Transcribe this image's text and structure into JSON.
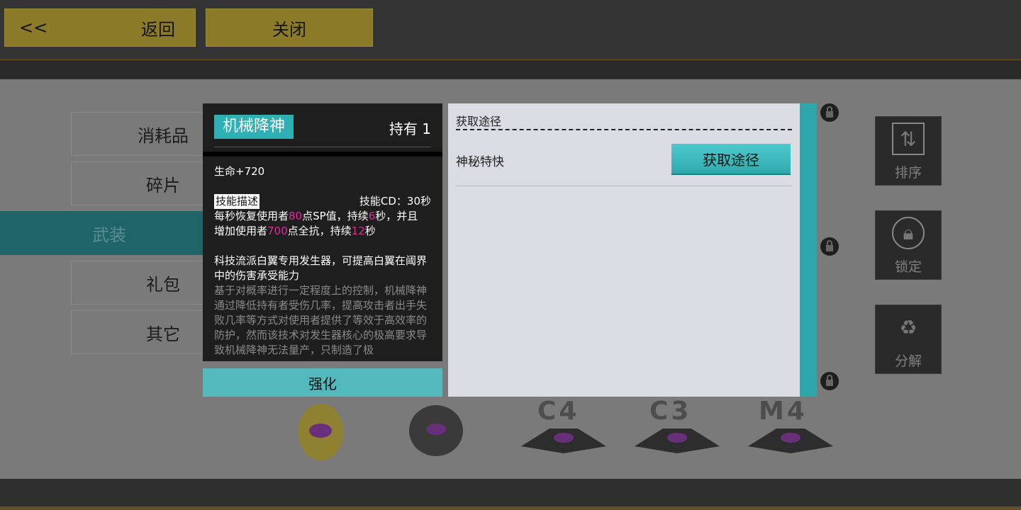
{
  "topbar": {
    "back_arrow": "<<",
    "back_label": "返回",
    "close_label": "关闭"
  },
  "categories": [
    "消耗品",
    "碎片",
    "武装",
    "礼包",
    "其它"
  ],
  "selected_category": "武装",
  "side_buttons": [
    {
      "label": "排序",
      "icon": "sort-icon"
    },
    {
      "label": "锁定",
      "icon": "lock-icon"
    },
    {
      "label": "分解",
      "icon": "recycle-icon"
    }
  ],
  "item_slots": [
    "",
    "",
    "C4",
    "C3",
    "M4"
  ],
  "detail": {
    "name": "机械降神",
    "hold": "持有 1",
    "stat": "生命+720",
    "skill_tag": "技能描述",
    "skill_cd": "技能CD：30秒",
    "skill_l1_a": "每秒恢复使用者",
    "skill_l1_v1": "80",
    "skill_l1_b": "点SP值，持续",
    "skill_l1_v2": "6",
    "skill_l1_c": "秒，并且",
    "skill_l2_a": "增加使用者",
    "skill_l2_v1": "700",
    "skill_l2_b": "点全抗，持续",
    "skill_l2_v2": "12",
    "skill_l2_c": "秒",
    "desc": "科技流派白翼专用发生器，可提高白翼在阈界中的伤害承受能力",
    "lore": "基于对概率进行一定程度上的控制，机械降神通过降低持有者受伤几率，提高攻击者出手失败几率等方式对使用者提供了等效于高效率的防护，然而该技术对发生器核心的极高要求导致机械降神无法量产，只制造了极",
    "enhance_label": "强化"
  },
  "source": {
    "header": "获取途径",
    "entry_name": "神秘特快",
    "button_label": "获取途径"
  },
  "colors": {
    "accent": "#2eb0b4",
    "gold": "#8b7a28",
    "highlight": "#e02c9c"
  }
}
